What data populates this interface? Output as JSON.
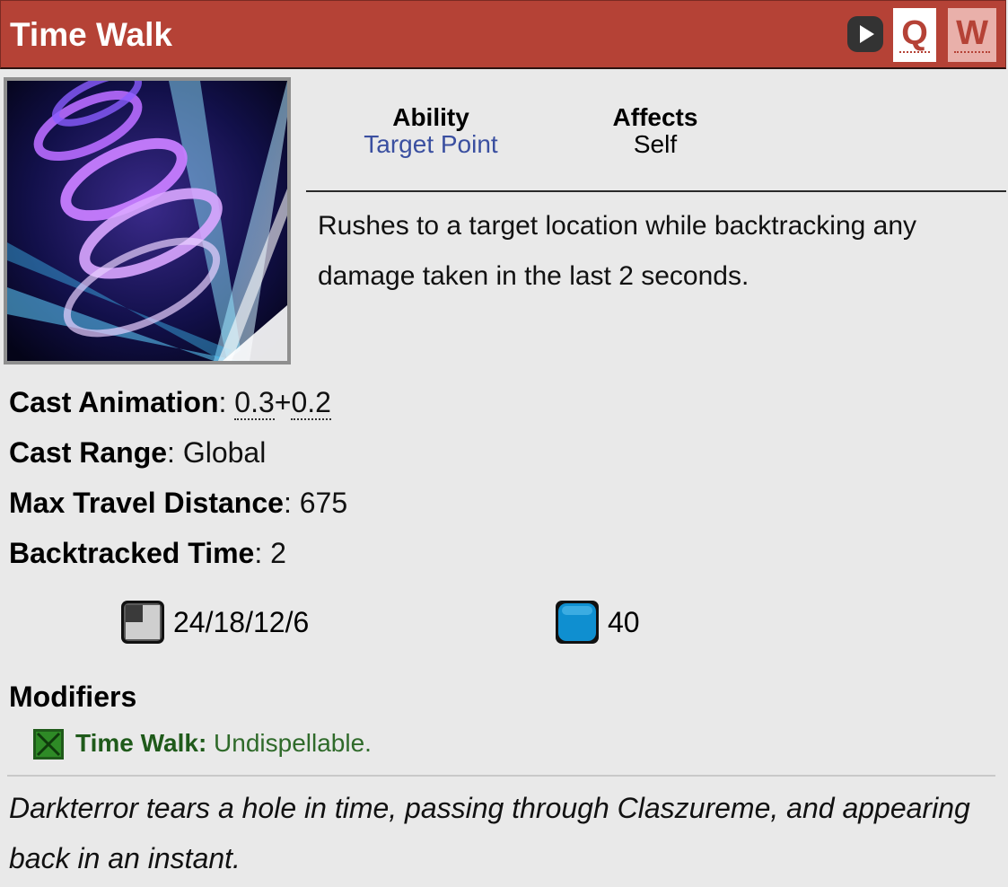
{
  "header": {
    "title": "Time Walk",
    "hotkeys": [
      "Q",
      "W"
    ]
  },
  "ability": {
    "type_label": "Ability",
    "type_value": "Target Point",
    "affects_label": "Affects",
    "affects_value": "Self",
    "description": "Rushes to a target location while backtracking any damage taken in the last 2 seconds."
  },
  "stats": {
    "cast_animation_label": "Cast Animation",
    "cast_animation_a": "0.3",
    "cast_animation_plus": "+",
    "cast_animation_b": "0.2",
    "cast_range_label": "Cast Range",
    "cast_range_value": "Global",
    "max_travel_label": "Max Travel Distance",
    "max_travel_value": "675",
    "backtracked_label": "Backtracked Time",
    "backtracked_value": "2",
    "separator": ": "
  },
  "costs": {
    "cooldown": "24/18/12/6",
    "mana": "40"
  },
  "modifiers": {
    "heading": "Modifiers",
    "items": [
      {
        "name": "Time Walk:",
        "value": " Undispellable."
      }
    ]
  },
  "lore": "Darkterror tears a hole in time, passing through Claszureme, and appearing back in an instant.",
  "colors": {
    "header_bg": "#b54236",
    "link_blue": "#3a4fa0",
    "modifier_green": "#2f6a2a",
    "mana_blue": "#0f8fd0"
  }
}
